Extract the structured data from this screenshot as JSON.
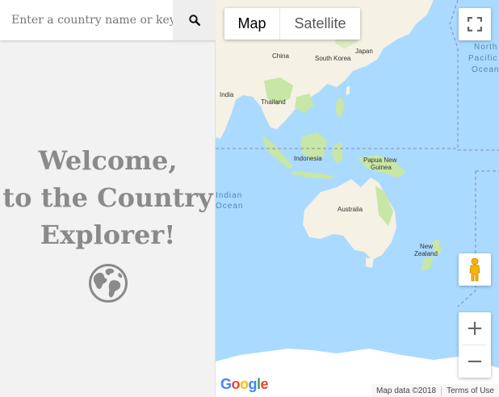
{
  "search": {
    "placeholder": "Enter a country name or keyword"
  },
  "welcome": {
    "line1": "Welcome,",
    "line2": "to the Country",
    "line3": "Explorer!"
  },
  "icons": {
    "search": "search-icon",
    "globe": "globe-icon",
    "fullscreen": "fullscreen-icon",
    "pegman": "pegman-icon"
  },
  "map": {
    "type_control": {
      "map_label": "Map",
      "satellite_label": "Satellite",
      "selected": "Map"
    },
    "labels": {
      "china": "China",
      "south_korea": "South Korea",
      "japan": "Japan",
      "india": "India",
      "thailand": "Thailand",
      "indonesia": "Indonesia",
      "papua_new_guinea_1": "Papua New",
      "papua_new_guinea_2": "Guinea",
      "australia": "Australia",
      "new_zealand_1": "New",
      "new_zealand_2": "Zealand"
    },
    "ocean_labels": {
      "north_pacific_1": "North",
      "north_pacific_2": "Pacific",
      "north_pacific_3": "Ocean",
      "indian_1": "Indian",
      "indian_2": "Ocean"
    },
    "zoom_in_label": "+",
    "zoom_out_label": "−",
    "attribution": {
      "map_data": "Map data ©2018",
      "terms": "Terms of Use"
    },
    "logo": {
      "letters": [
        "G",
        "o",
        "o",
        "g",
        "l",
        "e"
      ]
    }
  },
  "colors": {
    "water": "#aadaff",
    "land": "#f5f1e4",
    "land_green": "#c8e6a6",
    "antarctica": "#ffffff",
    "welcome_text": "#8a8a8a",
    "logo_blue": "#4285f4",
    "logo_red": "#ea4335",
    "logo_yellow": "#fbbc05",
    "logo_green": "#34a853"
  }
}
